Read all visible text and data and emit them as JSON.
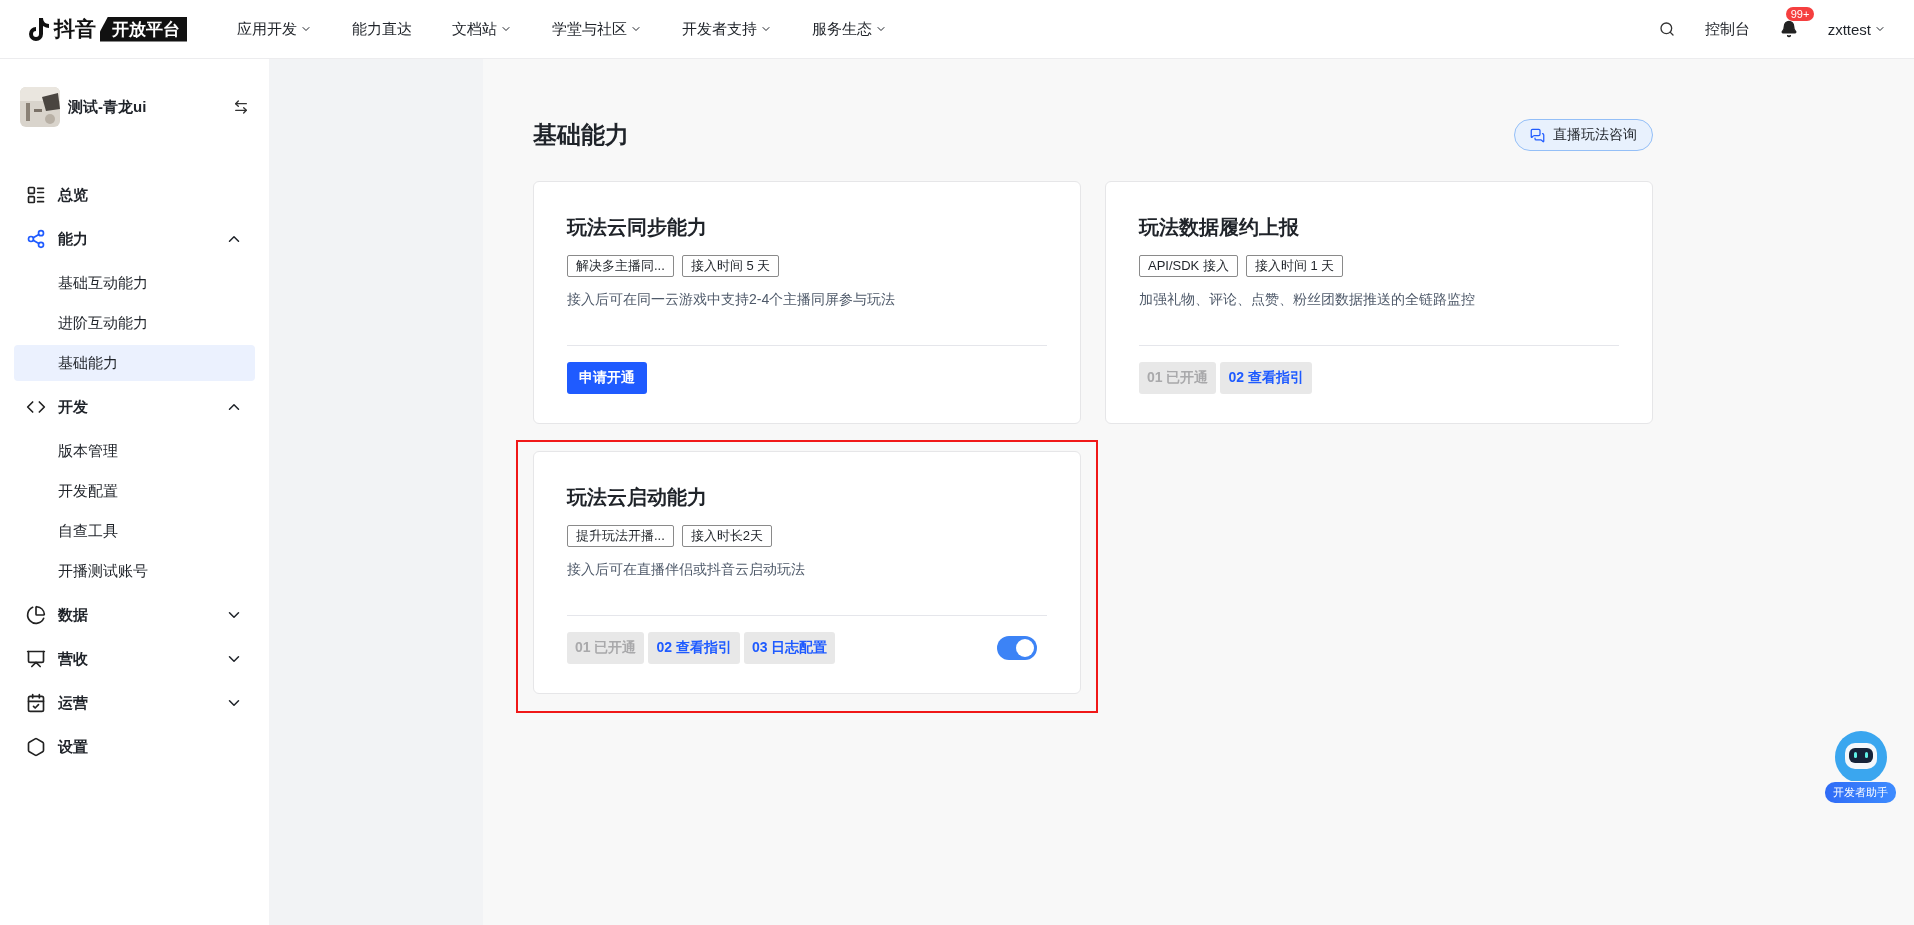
{
  "header": {
    "logo_mark": "抖音",
    "logo_badge": "开放平台",
    "nav": [
      {
        "label": "应用开发",
        "dropdown": true
      },
      {
        "label": "能力直达",
        "dropdown": false
      },
      {
        "label": "文档站",
        "dropdown": true
      },
      {
        "label": "学堂与社区",
        "dropdown": true
      },
      {
        "label": "开发者支持",
        "dropdown": true
      },
      {
        "label": "服务生态",
        "dropdown": true
      }
    ],
    "console": "控制台",
    "notification_count": "99+",
    "user": "zxttest"
  },
  "sidebar": {
    "app_name": "测试-青龙ui",
    "items": [
      {
        "label": "总览",
        "selected": false
      },
      {
        "label": "能力",
        "expandable": true,
        "expanded": true,
        "selected": true,
        "children": [
          {
            "label": "基础互动能力",
            "selected": false
          },
          {
            "label": "进阶互动能力",
            "selected": false
          },
          {
            "label": "基础能力",
            "selected": true
          }
        ]
      },
      {
        "label": "开发",
        "expandable": true,
        "expanded": true,
        "selected": false,
        "children": [
          {
            "label": "版本管理",
            "selected": false
          },
          {
            "label": "开发配置",
            "selected": false
          },
          {
            "label": "自查工具",
            "selected": false
          },
          {
            "label": "开播测试账号",
            "selected": false
          }
        ]
      },
      {
        "label": "数据",
        "expandable": true,
        "expanded": false,
        "selected": false
      },
      {
        "label": "营收",
        "expandable": true,
        "expanded": false,
        "selected": false
      },
      {
        "label": "运营",
        "expandable": true,
        "expanded": false,
        "selected": false
      },
      {
        "label": "设置",
        "selected": false
      }
    ]
  },
  "page": {
    "title": "基础能力",
    "consult_button": "直播玩法咨询",
    "cards": [
      {
        "title": "玩法云同步能力",
        "tags": [
          "解决多主播同...",
          "接入时间 5 天"
        ],
        "description": "接入后可在同一云游戏中支持2-4个主播同屏参与玩法",
        "footer": {
          "kind": "apply",
          "label": "申请开通"
        }
      },
      {
        "title": "玩法数据履约上报",
        "tags": [
          "API/SDK 接入",
          "接入时间 1 天"
        ],
        "description": "加强礼物、评论、点赞、粉丝团数据推送的全链路监控",
        "footer": {
          "kind": "steps",
          "steps": [
            {
              "label": "01 已开通",
              "done": true
            },
            {
              "label": "02 查看指引",
              "done": false
            }
          ]
        }
      },
      {
        "title": "玩法云启动能力",
        "tags": [
          "提升玩法开播...",
          "接入时长2天"
        ],
        "description": "接入后可在直播伴侣或抖音云启动玩法",
        "highlighted": true,
        "footer": {
          "kind": "steps",
          "steps": [
            {
              "label": "01 已开通",
              "done": true
            },
            {
              "label": "02 查看指引",
              "done": false
            },
            {
              "label": "03 日志配置",
              "done": false
            }
          ],
          "switch_on": true
        }
      }
    ]
  },
  "assistant": {
    "label": "开发者助手"
  }
}
